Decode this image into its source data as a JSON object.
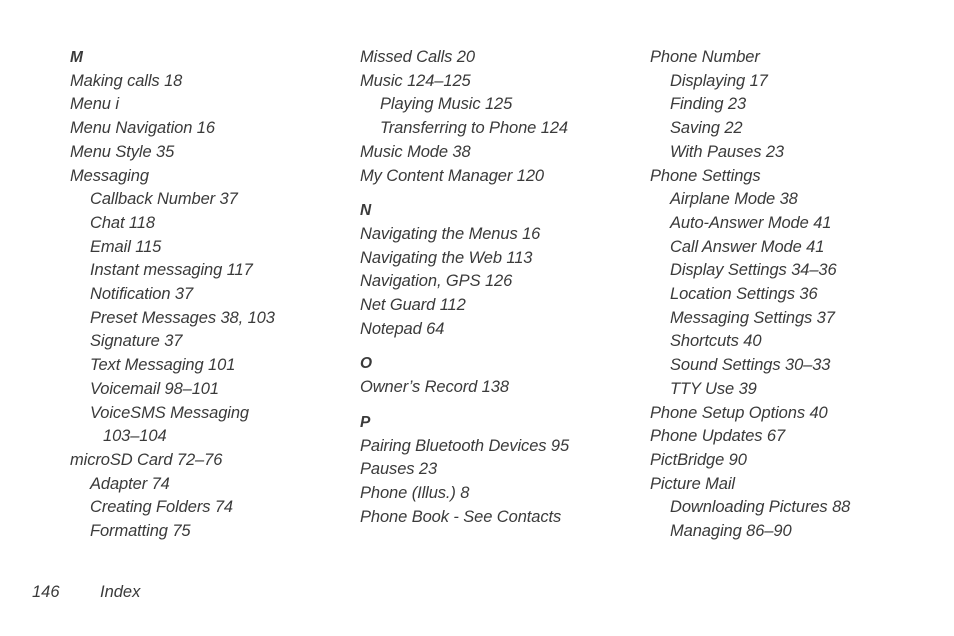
{
  "document": {
    "kind": "book-index-page",
    "footer": {
      "page_number": "146",
      "label": "Index"
    }
  },
  "columns": [
    {
      "name": "column-1",
      "blocks": [
        {
          "type": "section-letter",
          "text": "M"
        },
        {
          "type": "entry",
          "level": 0,
          "text": "Making calls  18"
        },
        {
          "type": "entry",
          "level": 0,
          "text": "Menu  i"
        },
        {
          "type": "entry",
          "level": 0,
          "text": "Menu Navigation  16"
        },
        {
          "type": "entry",
          "level": 0,
          "text": "Menu Style 35"
        },
        {
          "type": "entry",
          "level": 0,
          "text": "Messaging"
        },
        {
          "type": "entry",
          "level": 1,
          "text": "Callback Number 37"
        },
        {
          "type": "entry",
          "level": 1,
          "text": "Chat  118"
        },
        {
          "type": "entry",
          "level": 1,
          "text": "Email  115"
        },
        {
          "type": "entry",
          "level": 1,
          "text": "Instant messaging  117"
        },
        {
          "type": "entry",
          "level": 1,
          "text": "Notification  37"
        },
        {
          "type": "entry",
          "level": 1,
          "text": "Preset Messages  38, 103"
        },
        {
          "type": "entry",
          "level": 1,
          "text": "Signature 37"
        },
        {
          "type": "entry",
          "level": 1,
          "text": "Text Messaging  101"
        },
        {
          "type": "entry",
          "level": 1,
          "text": "Voicemail  98–101"
        },
        {
          "type": "entry",
          "level": 1,
          "text": "VoiceSMS Messaging"
        },
        {
          "type": "entry",
          "level": 2,
          "text": "103–104"
        },
        {
          "type": "entry",
          "level": 0,
          "text": "microSD Card  72–76"
        },
        {
          "type": "entry",
          "level": 1,
          "text": "Adapter 74"
        },
        {
          "type": "entry",
          "level": 1,
          "text": "Creating Folders 74"
        },
        {
          "type": "entry",
          "level": 1,
          "text": "Formatting  75"
        }
      ]
    },
    {
      "name": "column-2",
      "blocks": [
        {
          "type": "entry",
          "level": 0,
          "text": "Missed Calls  20"
        },
        {
          "type": "entry",
          "level": 0,
          "text": "Music  124–125"
        },
        {
          "type": "entry",
          "level": 1,
          "text": "Playing Music  125"
        },
        {
          "type": "entry",
          "level": 1,
          "text": "Transferring to Phone  124"
        },
        {
          "type": "entry",
          "level": 0,
          "text": "Music Mode 38"
        },
        {
          "type": "entry",
          "level": 0,
          "text": "My Content Manager 120"
        },
        {
          "type": "section-letter",
          "text": "N"
        },
        {
          "type": "entry",
          "level": 0,
          "text": "Navigating the Menus  16"
        },
        {
          "type": "entry",
          "level": 0,
          "text": "Navigating the Web  113"
        },
        {
          "type": "entry",
          "level": 0,
          "text": "Navigation, GPS  126"
        },
        {
          "type": "entry",
          "level": 0,
          "text": "Net Guard  112"
        },
        {
          "type": "entry",
          "level": 0,
          "text": "Notepad  64"
        },
        {
          "type": "section-letter",
          "text": "O"
        },
        {
          "type": "entry",
          "level": 0,
          "text": "Owner’s Record  138"
        },
        {
          "type": "section-letter",
          "text": "P"
        },
        {
          "type": "entry",
          "level": 0,
          "text": "Pairing Bluetooth Devices  95"
        },
        {
          "type": "entry",
          "level": 0,
          "text": "Pauses  23"
        },
        {
          "type": "entry",
          "level": 0,
          "text": "Phone (Illus.)  8"
        },
        {
          "type": "entry",
          "level": 0,
          "text": "Phone Book - See Contacts"
        }
      ]
    },
    {
      "name": "column-3",
      "blocks": [
        {
          "type": "entry",
          "level": 0,
          "text": "Phone Number"
        },
        {
          "type": "entry",
          "level": 1,
          "text": "Displaying  17"
        },
        {
          "type": "entry",
          "level": 1,
          "text": "Finding  23"
        },
        {
          "type": "entry",
          "level": 1,
          "text": "Saving  22"
        },
        {
          "type": "entry",
          "level": 1,
          "text": "With Pauses  23"
        },
        {
          "type": "entry",
          "level": 0,
          "text": "Phone Settings"
        },
        {
          "type": "entry",
          "level": 1,
          "text": "Airplane Mode  38"
        },
        {
          "type": "entry",
          "level": 1,
          "text": "Auto-Answer Mode  41"
        },
        {
          "type": "entry",
          "level": 1,
          "text": "Call Answer Mode  41"
        },
        {
          "type": "entry",
          "level": 1,
          "text": "Display Settings  34–36"
        },
        {
          "type": "entry",
          "level": 1,
          "text": "Location Settings 36"
        },
        {
          "type": "entry",
          "level": 1,
          "text": "Messaging Settings  37"
        },
        {
          "type": "entry",
          "level": 1,
          "text": "Shortcuts  40"
        },
        {
          "type": "entry",
          "level": 1,
          "text": "Sound Settings  30–33"
        },
        {
          "type": "entry",
          "level": 1,
          "text": "TTY Use 39"
        },
        {
          "type": "entry",
          "level": 0,
          "text": "Phone Setup Options  40"
        },
        {
          "type": "entry",
          "level": 0,
          "text": "Phone Updates  67"
        },
        {
          "type": "entry",
          "level": 0,
          "text": "PictBridge  90"
        },
        {
          "type": "entry",
          "level": 0,
          "text": "Picture Mail"
        },
        {
          "type": "entry",
          "level": 1,
          "text": "Downloading Pictures  88"
        },
        {
          "type": "entry",
          "level": 1,
          "text": "Managing  86–90"
        }
      ]
    }
  ],
  "colors": {
    "text": "#3a3a3a",
    "background": "#ffffff"
  }
}
